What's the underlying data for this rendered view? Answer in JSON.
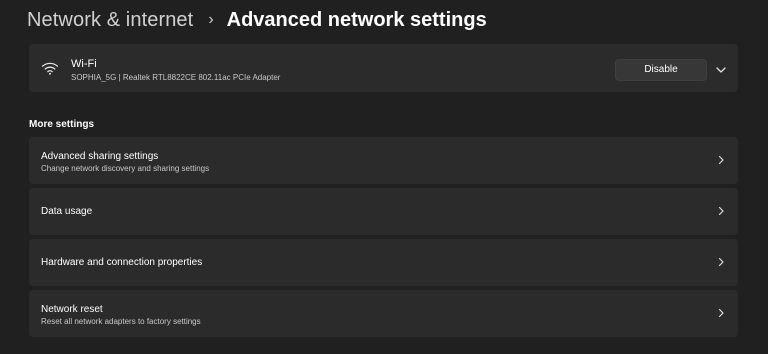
{
  "breadcrumb": {
    "parent": "Network & internet",
    "separator": "›",
    "current": "Advanced network settings"
  },
  "adapter": {
    "icon": "wifi-icon",
    "name": "Wi-Fi",
    "description": "SOPHIA_5G | Realtek RTL8822CE 802.11ac PCIe Adapter",
    "disable_label": "Disable",
    "expand_icon": "chevron-down-icon"
  },
  "more_settings": {
    "header": "More settings",
    "items": [
      {
        "title": "Advanced sharing settings",
        "subtitle": "Change network discovery and sharing settings"
      },
      {
        "title": "Data usage"
      },
      {
        "title": "Hardware and connection properties"
      },
      {
        "title": "Network reset",
        "subtitle": "Reset all network adapters to factory settings"
      }
    ]
  },
  "colors": {
    "background": "#202020",
    "card": "#2b2b2b",
    "button": "#373737",
    "text": "#ffffff",
    "secondary_text": "#c8c8c8"
  }
}
